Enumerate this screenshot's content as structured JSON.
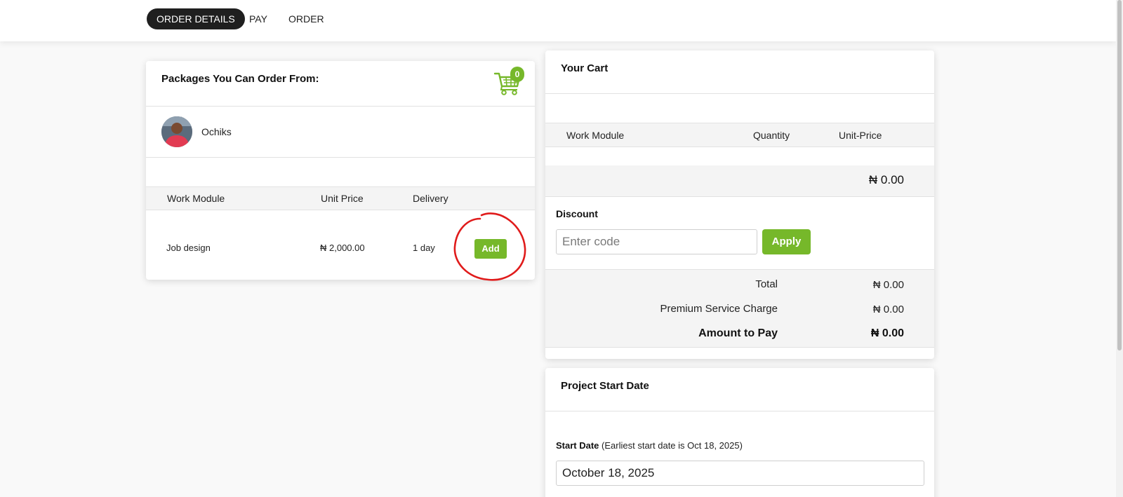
{
  "nav": {
    "tabs": [
      {
        "label": "ORDER DETAILS",
        "active": true
      },
      {
        "label": "PAY",
        "active": false
      },
      {
        "label": "ORDER",
        "active": false
      }
    ]
  },
  "packages": {
    "title": "Packages You Can Order From:",
    "cart_count": "0",
    "seller": {
      "name": "Ochiks"
    },
    "columns": [
      "Work Module",
      "Unit Price",
      "Delivery"
    ],
    "rows": [
      {
        "module": "Job design",
        "price": "₦ 2,000.00",
        "delivery": "1 day",
        "action": "Add"
      }
    ]
  },
  "cart": {
    "title": "Your Cart",
    "columns": [
      "Work Module",
      "Quantity",
      "Unit-Price"
    ],
    "subtotal": "₦ 0.00",
    "discount": {
      "label": "Discount",
      "placeholder": "Enter code",
      "apply_label": "Apply"
    },
    "summary": [
      {
        "label": "Total",
        "value": "₦ 0.00"
      },
      {
        "label": "Premium Service Charge",
        "value": "₦ 0.00"
      },
      {
        "label": "Amount to Pay",
        "value": "₦ 0.00"
      }
    ]
  },
  "project": {
    "title": "Project Start Date",
    "start_label": "Start Date",
    "start_note": "(Earliest start date is Oct 18, 2025)",
    "start_value": "October 18, 2025"
  },
  "colors": {
    "accent": "#76b82a",
    "annotation": "#e01b1b",
    "nav_active": "#1f1f1f"
  }
}
